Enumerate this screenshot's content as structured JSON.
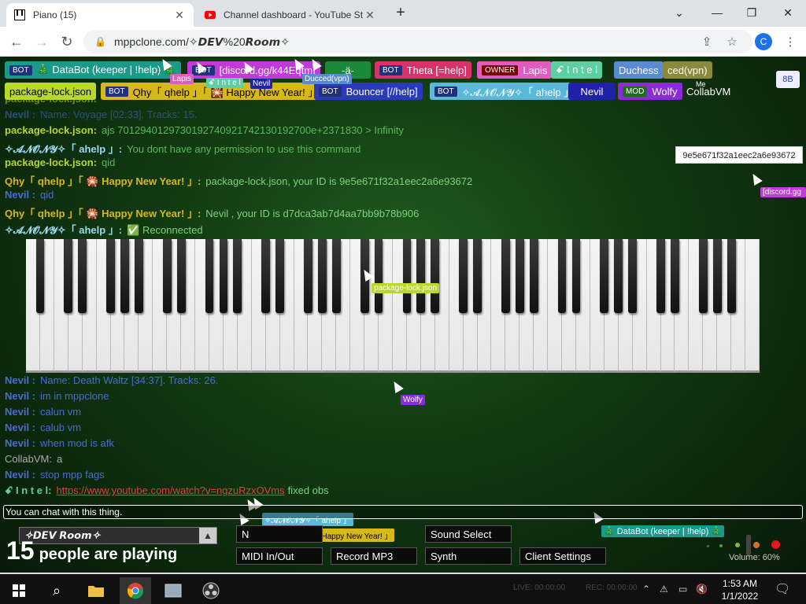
{
  "browser": {
    "tabs": [
      {
        "title": "Piano (15)",
        "active": true
      },
      {
        "title": "Channel dashboard - YouTube St",
        "active": false
      }
    ],
    "url": "mppclone.com/✧𝘿𝙀𝙑%20𝙍𝙤𝙤𝙢✧",
    "profile_initial": "C"
  },
  "room_users_row1": [
    {
      "badge": "BOT",
      "name": "🎄 DataBot (keeper | !help) 🎄",
      "color": "#1a9a8a"
    },
    {
      "badge": "BOT",
      "name": "[discord.gg/k44Eqtm]",
      "color": "#c03bd8"
    },
    {
      "badge": "",
      "name": "-ä-",
      "color": "#1a8a3a"
    },
    {
      "badge": "BOT",
      "name": "Theta [=help]",
      "color": "#d8326a"
    },
    {
      "badge": "OWNER",
      "name": "Lapis",
      "color": "#e05cc0"
    },
    {
      "badge": "",
      "name": "ꗃ I n t e l",
      "color": "#5cd0a0"
    },
    {
      "badge": "",
      "name": "Duchess",
      "color": "#5a8ad0"
    },
    {
      "badge": "",
      "name": "ced(vpn)",
      "color": "#8a8a3a"
    }
  ],
  "room_users_row2": [
    {
      "badge": "",
      "name": "package-lock.json",
      "color": "#b8d82a"
    },
    {
      "badge": "BOT",
      "name": "Qhy「 qhelp 」「 🎇 Happy New Year! 」",
      "color": "#d8b818"
    },
    {
      "badge": "BOT",
      "name": "Bouncer [//help]",
      "color": "#2a3ab8"
    },
    {
      "badge": "BOT",
      "name": "✧𝓐𝓝𝓞𝓝𝓨✧「 ahelp 」",
      "color": "#5ab8d8"
    },
    {
      "badge": "",
      "name": "Nevil",
      "color": "#2020a8"
    },
    {
      "badge": "MOD",
      "name": "Wolfy",
      "color": "#8a2ad8"
    },
    {
      "badge": "",
      "name": "CollabVM",
      "color": "transparent"
    }
  ],
  "me_label": "Me",
  "bb_button": "8B",
  "tooltip_id": "9e5e671f32a1eec2a6e93672",
  "chat": [
    {
      "who": "package-lock.json:",
      "color": "#b8d82a",
      "text": "",
      "top": 0,
      "dim": true
    },
    {
      "who": "Nevil :",
      "color": "#4a6ad8",
      "text": "Name: Voyage [02:33]. Tracks: 15.",
      "dim": true
    },
    {
      "who": "package-lock.json:",
      "color": "#b8d82a",
      "text": "ajs 7012940129730192740921742130192700e+2371830 > Infinity"
    },
    {
      "who": "✧𝓐𝓝𝓞𝓝𝓨✧「 ahelp 」:",
      "color": "#9ad8f0",
      "text": "You dont have any permission to use this command"
    },
    {
      "who": "package-lock.json:",
      "color": "#b8d82a",
      "text": "qid"
    },
    {
      "who": "Qhy「 qhelp 」「 🎇 Happy New Year! 」:",
      "color": "#d8b818",
      "text": "package-lock.json, your ID is 9e5e671f32a1eec2a6e93672"
    },
    {
      "who": "Nevil :",
      "color": "#4a6ad8",
      "text": "qid"
    },
    {
      "who": "Qhy「 qhelp 」「 🎇 Happy New Year! 」:",
      "color": "#d8b818",
      "text": "Nevil , your ID is d7dca3ab7d4aa7bb9b78b906"
    },
    {
      "who": "✧𝓐𝓝𝓞𝓝𝓨✧「 ahelp 」:",
      "color": "#9ad8f0",
      "text": "✅ Reconnected"
    }
  ],
  "chat_lower": [
    {
      "who": "Nevil :",
      "color": "#4a6ad8",
      "text": "Name: Death Waltz [34:37]. Tracks: 26."
    },
    {
      "who": "Nevil :",
      "color": "#4a6ad8",
      "text": "im in mppclone"
    },
    {
      "who": "Nevil :",
      "color": "#4a6ad8",
      "text": "calun vm"
    },
    {
      "who": "Nevil :",
      "color": "#4a6ad8",
      "text": "calub vm"
    },
    {
      "who": "Nevil :",
      "color": "#4a6ad8",
      "text": "when mod is afk"
    },
    {
      "who": "CollabVM:",
      "color": "#aaaaaa",
      "text": "a"
    },
    {
      "who": "Nevil :",
      "color": "#4a6ad8",
      "text": "stop mpp fags"
    },
    {
      "who": "ꗃ I n t e l:",
      "color": "#5cd0a0",
      "text": "fixed obs",
      "link": "https://www.youtube.com/watch?v=ngzuRzxOVms"
    }
  ],
  "cursor_labels": {
    "lapis": "Lapis",
    "intel": "ꗃ I n t e l",
    "nevil": "Nevil",
    "ducced": "Ducced(vpn)",
    "package": "package-lock.json",
    "wolfy": "Wolfy",
    "discord": "[discord.gg",
    "anony": "✧𝓐𝓝𝓞𝓝𝓨✧「 ahelp 」",
    "qhy": "Qhy「 qhelp 」「 🎇 Happy New Year! 」",
    "databot": "🎄 DataBot (keeper | !help) 🎄"
  },
  "chat_input_placeholder": "You can chat with this thing.",
  "room_name": "✧𝘿𝙀𝙑 𝙍𝙤𝙤𝙢✧",
  "players": {
    "count": "15",
    "text": "people are playing"
  },
  "controls": {
    "new_room": "N",
    "sound_select": "Sound Select",
    "midi": "MIDI In/Out",
    "record": "Record MP3",
    "synth": "Synth",
    "client_settings": "Client Settings"
  },
  "volume": "Volume: 60%",
  "taskbar": {
    "time": "1:53 AM",
    "date": "1/1/2022",
    "live": "LIVE: 00:00:00",
    "rec": "REC: 00:00:00"
  }
}
